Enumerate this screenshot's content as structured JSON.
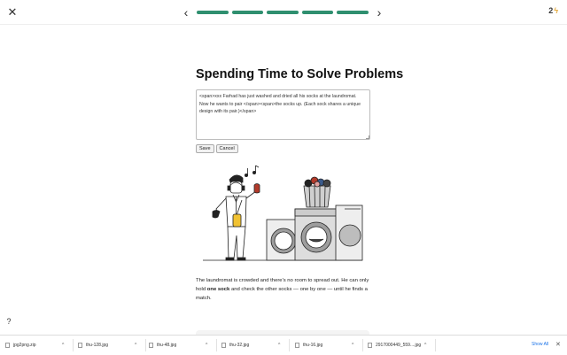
{
  "topbar": {
    "close_glyph": "✕",
    "prev_glyph": "‹",
    "next_glyph": "›",
    "progress_segments": 5,
    "progress_completed": 5,
    "progress_color": "#2f8f6f",
    "streak_count": "2",
    "streak_icon": "lightning-icon"
  },
  "lesson": {
    "title": "Spending Time to Solve Problems",
    "editor_text": "<span>xxx Farhad has just washed and dried all his socks at the laundromat. Now he wants to pair </span><span>the socks up. (Each sock shares a unique design with its pair.)</span>",
    "save_label": "Save",
    "cancel_label": "Cancel",
    "paragraph_before": "The laundromat is crowded and there's no room to spread out. He can only hold ",
    "paragraph_bold": "one sock",
    "paragraph_after": " and check the other socks — one by one — until he finds a match."
  },
  "help_glyph": "?",
  "downloads": {
    "items": [
      {
        "name": "jpg2png.zip"
      },
      {
        "name": "thu-128.jpg"
      },
      {
        "name": "thu-48.jpg"
      },
      {
        "name": "thu-32.jpg"
      },
      {
        "name": "thu-16.jpg"
      },
      {
        "name": "2917000449_559....jpg"
      }
    ],
    "chevron_glyph": "^",
    "show_all_label": "Show All",
    "close_glyph": "✕"
  }
}
